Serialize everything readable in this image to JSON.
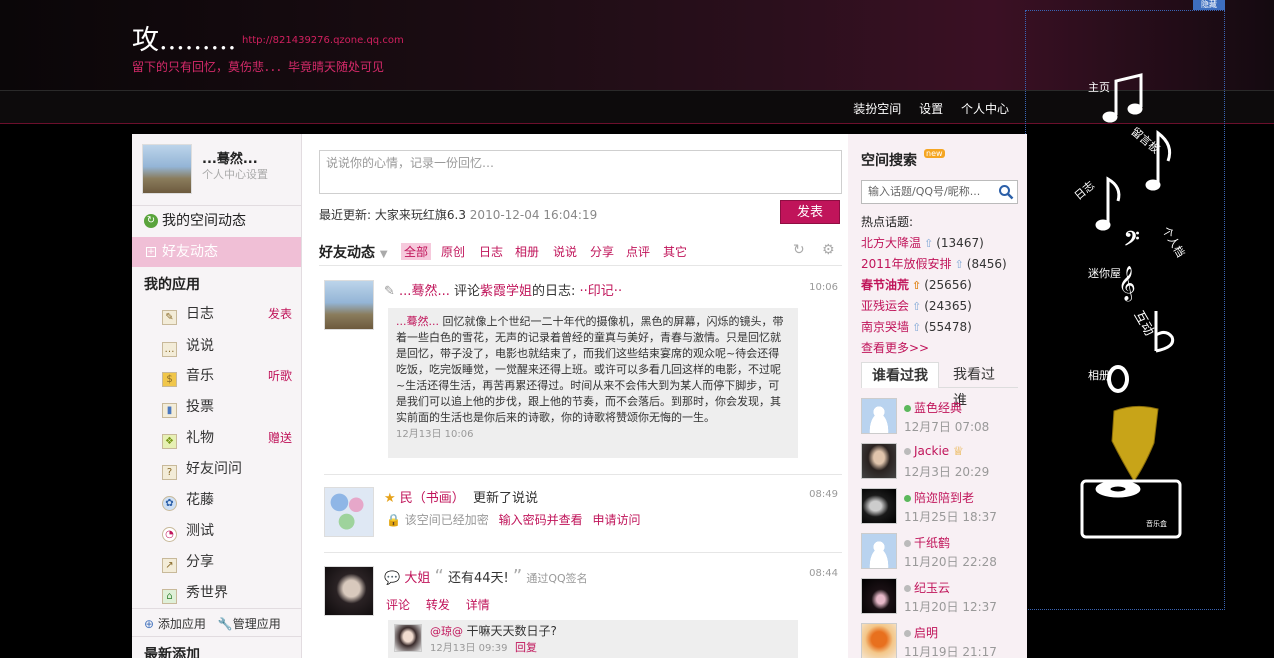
{
  "header": {
    "title": "攻.........",
    "url": "http://821439276.qzone.qq.com",
    "subtitle": "留下的只有回忆，莫伤悲．．．毕竟晴天随处可见"
  },
  "nav": [
    "装扮空间",
    "设置",
    "个人中心"
  ],
  "hide_label": "隐藏",
  "music_widget": {
    "labels": [
      "主页",
      "留言板",
      "日志",
      "个人档",
      "迷你屋",
      "互动",
      "相册",
      "音乐盒"
    ]
  },
  "user": {
    "name": "...蓦然...",
    "settings_link": "个人中心设置"
  },
  "left_nav": [
    {
      "label": "我的空间动态"
    },
    {
      "label": "好友动态"
    }
  ],
  "apps_title": "我的应用",
  "apps": [
    {
      "label": "日志",
      "action": "发表",
      "icon": "diary-icon"
    },
    {
      "label": "说说",
      "action": "",
      "icon": "speech-icon"
    },
    {
      "label": "音乐",
      "action": "听歌",
      "icon": "music-icon"
    },
    {
      "label": "投票",
      "action": "",
      "icon": "vote-icon"
    },
    {
      "label": "礼物",
      "action": "赠送",
      "icon": "gift-icon"
    },
    {
      "label": "好友问问",
      "action": "",
      "icon": "question-icon"
    },
    {
      "label": "花藤",
      "action": "",
      "icon": "flower-icon"
    },
    {
      "label": "测试",
      "action": "",
      "icon": "test-icon"
    },
    {
      "label": "分享",
      "action": "",
      "icon": "share-icon"
    },
    {
      "label": "秀世界",
      "action": "",
      "icon": "show-world-icon"
    }
  ],
  "app_footer": {
    "add": "添加应用",
    "manage": "管理应用"
  },
  "recent_title": "最新添加",
  "composer": {
    "placeholder": "说说你的心情，记录一份回忆…",
    "last_update_label": "最近更新:",
    "last_update_text": "大家来玩红旗6.3",
    "last_update_time": "2010-12-04 16:04:19",
    "publish": "发表"
  },
  "feed": {
    "title": "好友动态",
    "tabs": [
      "全部",
      "原创",
      "日志",
      "相册",
      "说说",
      "分享",
      "点评",
      "其它"
    ],
    "items": [
      {
        "user": "...蓦然...",
        "action": "评论",
        "target": "紫霞学姐",
        "suffix": "的日志:",
        "title": "··印记··",
        "time": "10:06",
        "quote_user": "...蓦然...",
        "quote": "回忆就像上个世纪一二十年代的摄像机，黑色的屏幕，闪烁的镜头，带着一些白色的雪花，无声的记录着曾经的童真与美好，青春与激情。只是回忆就是回忆，带子没了，电影也就结束了，而我们这些结束宴席的观众呢~待会还得吃饭，吃完饭睡觉，一觉醒来还得上班。或许可以多看几回这样的电影，不过呢~生活还得生活，再苦再累还得过。时间从来不会伟大到为某人而停下脚步，可是我们可以追上他的步伐，跟上他的节奏，而不会落后。到那时，你会发现，其实前面的生活也是你后来的诗歌，你的诗歌将赞颂你无悔的一生。",
        "quote_time": "12月13日 10:06"
      },
      {
        "user": "民（书画）",
        "action": "更新了说说",
        "time": "08:49",
        "lock_text": "该空间已经加密",
        "link1": "输入密码并查看",
        "link2": "申请访问"
      },
      {
        "user": "大姐",
        "text": "还有44天!",
        "via": "通过QQ签名",
        "time": "08:44",
        "actions": [
          "评论",
          "转发",
          "详情"
        ],
        "reply_user": "@琼@",
        "reply_text": "干嘛天天数日子?",
        "reply_time": "12月13日 09:39",
        "reply_action": "回复"
      }
    ]
  },
  "right": {
    "search_title": "空间搜索",
    "new_badge": "new",
    "search_placeholder": "输入话题/QQ号/昵称...",
    "hot_title": "热点话题:",
    "hot": [
      {
        "topic": "北方大降温",
        "count": "(13467)"
      },
      {
        "topic": "2011年放假安排",
        "count": "(8456)"
      },
      {
        "topic": "春节油荒",
        "count": "(25656)"
      },
      {
        "topic": "亚残运会",
        "count": "(24365)"
      },
      {
        "topic": "南京哭墙",
        "count": "(55478)"
      }
    ],
    "more": "查看更多>>",
    "tabs": [
      "谁看过我",
      "我看过谁"
    ],
    "visitors": [
      {
        "name": "蓝色经典",
        "time": "12月7日 07:08",
        "online": true
      },
      {
        "name": "Jackie",
        "time": "12月3日 20:29",
        "online": false
      },
      {
        "name": "陪迩陪到老",
        "time": "11月25日 18:37",
        "online": true
      },
      {
        "name": "千纸鹤",
        "time": "11月20日 22:28",
        "online": false
      },
      {
        "name": "纪玉云",
        "time": "11月20日 12:37",
        "online": false
      },
      {
        "name": "启明",
        "time": "11月19日 21:17",
        "online": false
      }
    ]
  }
}
